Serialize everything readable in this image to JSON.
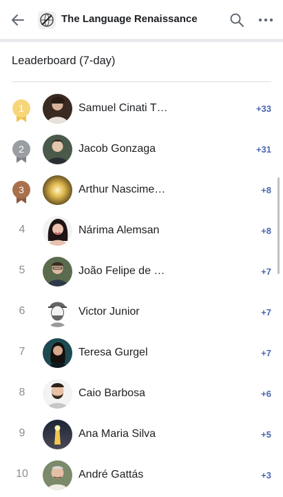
{
  "header": {
    "title": "The Language Renaissance",
    "back_icon": "arrow-left-icon",
    "group_icon": "group-logo-icon",
    "search_icon": "search-icon",
    "more_icon": "more-horizontal-icon"
  },
  "leaderboard": {
    "title": "Leaderboard (7-day)",
    "accent_color": "#4a66ad",
    "rows": [
      {
        "rank": "1",
        "name": "Samuel Cinati T…",
        "score": "+33",
        "medal": "gold"
      },
      {
        "rank": "2",
        "name": "Jacob Gonzaga",
        "score": "+31",
        "medal": "silver"
      },
      {
        "rank": "3",
        "name": "Arthur Nascime…",
        "score": "+8",
        "medal": "bronze"
      },
      {
        "rank": "4",
        "name": "Nárima Alemsan",
        "score": "+8"
      },
      {
        "rank": "5",
        "name": "João Felipe de …",
        "score": "+7"
      },
      {
        "rank": "6",
        "name": "Victor Junior",
        "score": "+7"
      },
      {
        "rank": "7",
        "name": "Teresa Gurgel",
        "score": "+7"
      },
      {
        "rank": "8",
        "name": "Caio Barbosa",
        "score": "+6"
      },
      {
        "rank": "9",
        "name": "Ana Maria Silva",
        "score": "+5"
      },
      {
        "rank": "10",
        "name": "André Gattás",
        "score": "+3"
      }
    ]
  }
}
